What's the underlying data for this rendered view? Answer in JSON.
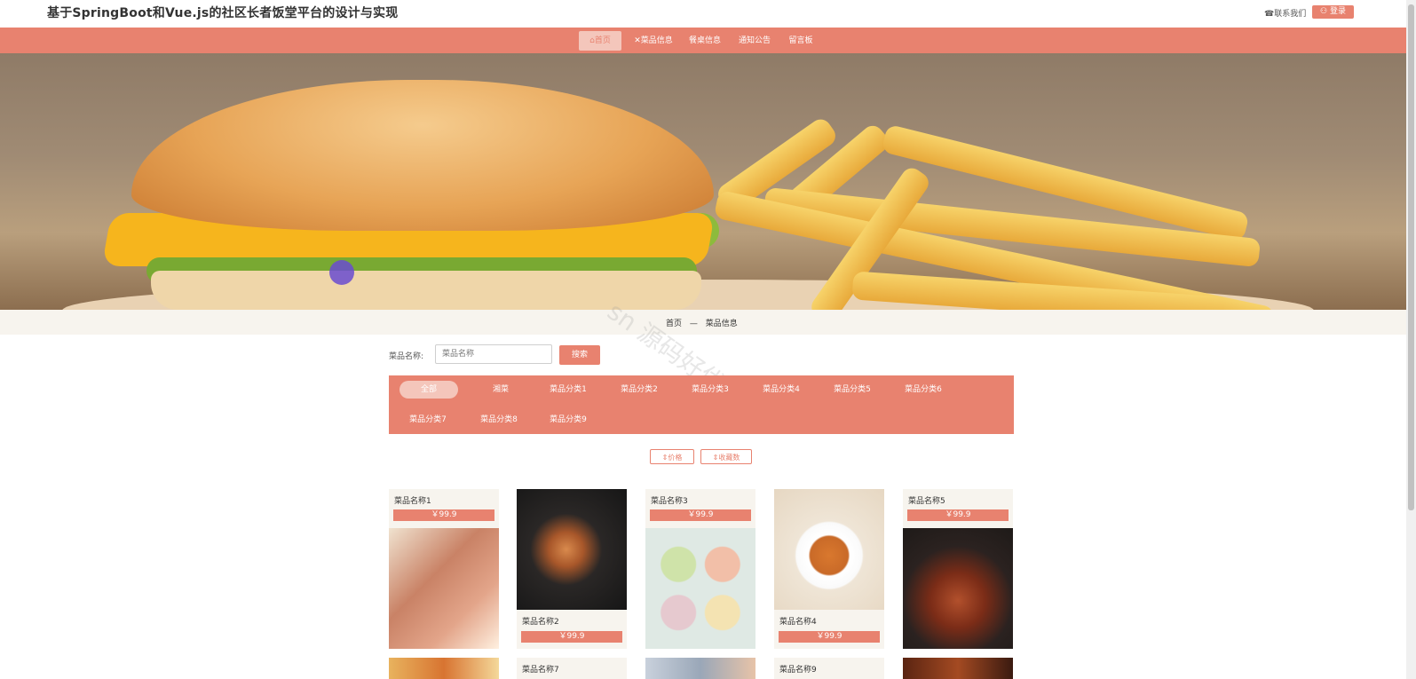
{
  "site": {
    "title": "基于SpringBoot和Vue.js的社区长者饭堂平台的设计与实现",
    "contact": "☎联系我们",
    "login": "⚇ 登录"
  },
  "nav": [
    {
      "label": "⌂首页"
    },
    {
      "label": "✕菜品信息"
    },
    {
      "label": "餐桌信息"
    },
    {
      "label": "通知公告"
    },
    {
      "label": "留言板"
    }
  ],
  "breadcrumb": {
    "home": "首页",
    "sep": "—",
    "current": "菜品信息"
  },
  "search": {
    "label": "菜品名称:",
    "placeholder": "菜品名称",
    "button": "搜索"
  },
  "categories": [
    "全部",
    "湘菜",
    "菜品分类1",
    "菜品分类2",
    "菜品分类3",
    "菜品分类4",
    "菜品分类5",
    "菜品分类6",
    "菜品分类7",
    "菜品分类8",
    "菜品分类9"
  ],
  "sort": {
    "price": "⇕价格",
    "favorites": "⇕收藏数"
  },
  "items": [
    {
      "name": "菜品名称1",
      "price": "￥99.9"
    },
    {
      "name": "菜品名称2",
      "price": "￥99.9"
    },
    {
      "name": "菜品名称3",
      "price": "￥99.9"
    },
    {
      "name": "菜品名称4",
      "price": "￥99.9"
    },
    {
      "name": "菜品名称5",
      "price": "￥99.9"
    },
    {
      "name": "菜品名称7",
      "price": ""
    },
    {
      "name": "菜品名称9",
      "price": ""
    }
  ],
  "colors": {
    "accent": "#e8826f",
    "accent_light": "#f4c6bb",
    "strip": "#f7f4ee"
  }
}
